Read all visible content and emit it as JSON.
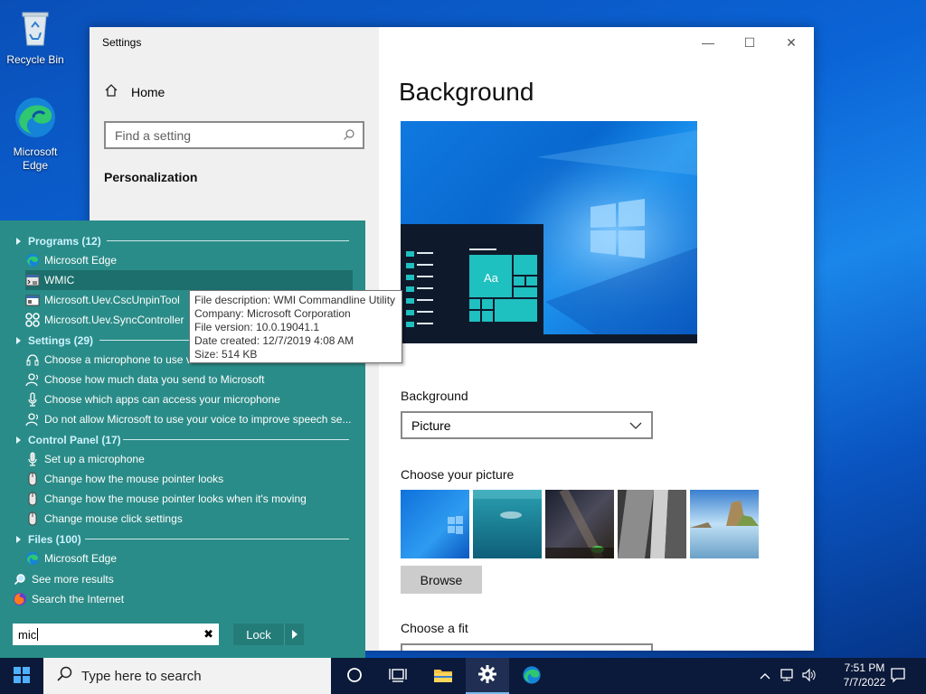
{
  "desktop": {
    "icons": [
      {
        "label": "Recycle Bin",
        "icon": "recycle-bin-icon"
      },
      {
        "label": "Microsoft Edge",
        "icon": "edge-icon"
      }
    ]
  },
  "settings_window": {
    "title": "Settings",
    "controls": {
      "minimize": "—",
      "maximize": "☐",
      "close": "✕"
    },
    "home_label": "Home",
    "find_placeholder": "Find a setting",
    "section": "Personalization",
    "page_title": "Background",
    "preview_tile_text": "Aa",
    "background_label": "Background",
    "background_value": "Picture",
    "choose_picture_label": "Choose your picture",
    "browse_label": "Browse",
    "choose_fit_label": "Choose a fit"
  },
  "search_popup": {
    "groups": [
      {
        "title": "Programs (12)",
        "items": [
          {
            "label": "Microsoft Edge",
            "icon": "edge-icon"
          },
          {
            "label": "WMIC",
            "icon": "wmic-icon",
            "selected": true
          },
          {
            "label": "Microsoft.Uev.CscUnpinTool",
            "icon": "app-window-icon"
          },
          {
            "label": "Microsoft.Uev.SyncController",
            "icon": "sync-controller-icon"
          }
        ]
      },
      {
        "title": "Settings (29)",
        "items": [
          {
            "label": "Choose a microphone to use voice activation in Windows Security",
            "icon": "headset-icon"
          },
          {
            "label": "Choose how much data you send to Microsoft",
            "icon": "person-voice-icon"
          },
          {
            "label": "Choose which apps can access your microphone",
            "icon": "microphone-icon"
          },
          {
            "label": "Do not allow Microsoft to use your voice to improve speech se...",
            "icon": "person-voice-icon"
          }
        ]
      },
      {
        "title": "Control Panel (17)",
        "items": [
          {
            "label": "Set up a microphone",
            "icon": "microphone-icon"
          },
          {
            "label": "Change how the mouse pointer looks",
            "icon": "mouse-icon"
          },
          {
            "label": "Change how the mouse pointer looks when it's moving",
            "icon": "mouse-icon"
          },
          {
            "label": "Change mouse click settings",
            "icon": "mouse-icon"
          }
        ]
      },
      {
        "title": "Files (100)",
        "items": [
          {
            "label": "Microsoft Edge",
            "icon": "edge-icon"
          }
        ]
      }
    ],
    "see_more": "See more results",
    "search_internet": "Search the Internet",
    "query": "mic",
    "lock_label": "Lock"
  },
  "tooltip": {
    "lines": [
      "File description: WMI Commandline Utility",
      "Company: Microsoft Corporation",
      "File version: 10.0.19041.1",
      "Date created: 12/7/2019 4:08 AM",
      "Size: 514 KB"
    ]
  },
  "taskbar": {
    "search_placeholder": "Type here to search",
    "time": "7:51 PM",
    "date": "7/7/2022"
  }
}
